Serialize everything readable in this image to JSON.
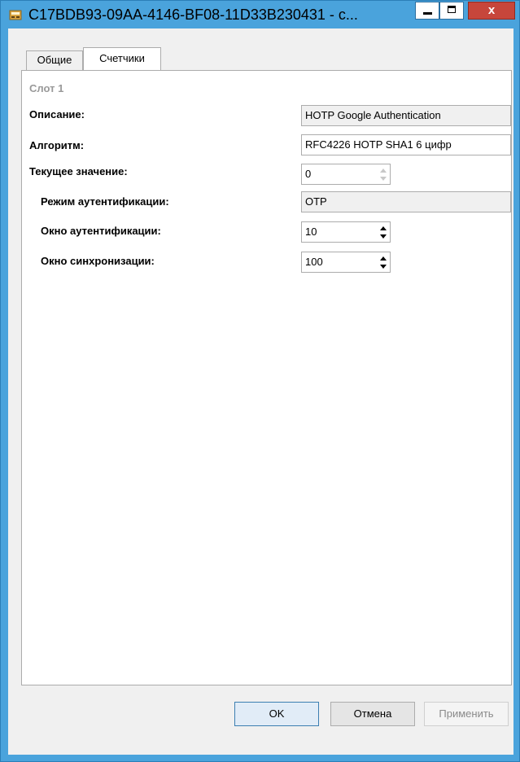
{
  "window": {
    "title": "C17BDB93-09AA-4146-BF08-11D33B230431 - с...",
    "close_label": "x"
  },
  "tabs": [
    {
      "label": "Общие"
    },
    {
      "label": "Счетчики"
    }
  ],
  "slot": {
    "title": "Слот 1",
    "fields": {
      "description": {
        "label": "Описание:",
        "value": "HOTP Google Authentication"
      },
      "algorithm": {
        "label": "Алгоритм:",
        "value": "RFC4226 HOTP SHA1 6 цифр"
      },
      "current_value": {
        "label": "Текущее значение:",
        "value": "0"
      },
      "auth_mode": {
        "label": "Режим аутентификации:",
        "value": "OTP"
      },
      "auth_window": {
        "label": "Окно аутентификации:",
        "value": "10"
      },
      "sync_window": {
        "label": "Окно синхронизации:",
        "value": "100"
      }
    }
  },
  "buttons": {
    "ok": "OK",
    "cancel": "Отмена",
    "apply": "Применить"
  },
  "colors": {
    "title_bar": "#4aa3dc",
    "close_button": "#c7463b",
    "disabled_text": "#8a8a8a"
  }
}
